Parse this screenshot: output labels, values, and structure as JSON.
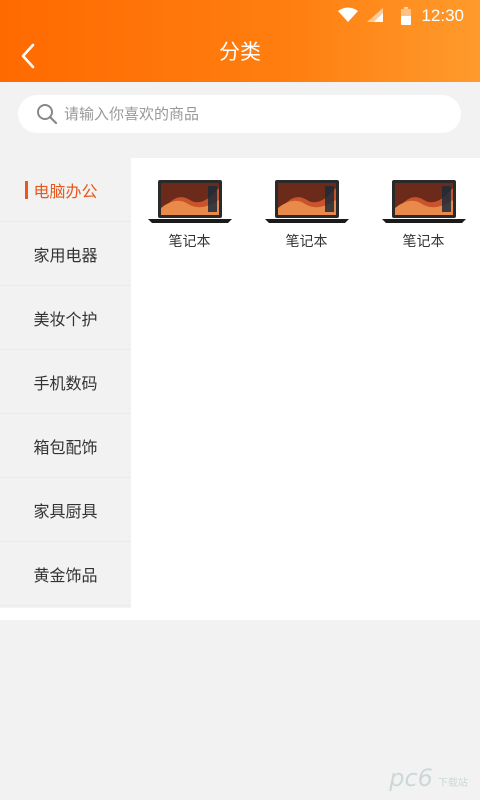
{
  "status_bar": {
    "time": "12:30",
    "icons": [
      "wifi-icon",
      "signal-icon",
      "battery-icon"
    ]
  },
  "header": {
    "title": "分类",
    "back_icon": "back-arrow-icon",
    "gradient_start": "#ff6a00",
    "gradient_end": "#ff9a2c"
  },
  "search": {
    "placeholder": "请输入你喜欢的商品",
    "value": "",
    "icon": "search-icon"
  },
  "sidebar": {
    "active_color": "#e8581c",
    "items": [
      {
        "label": "电脑办公",
        "active": true
      },
      {
        "label": "家用电器",
        "active": false
      },
      {
        "label": "美妆个护",
        "active": false
      },
      {
        "label": "手机数码",
        "active": false
      },
      {
        "label": "箱包配饰",
        "active": false
      },
      {
        "label": "家具厨具",
        "active": false
      },
      {
        "label": "黄金饰品",
        "active": false
      }
    ]
  },
  "products": [
    {
      "name": "笔记本",
      "icon": "laptop-image"
    },
    {
      "name": "笔记本",
      "icon": "laptop-image"
    },
    {
      "name": "笔记本",
      "icon": "laptop-image"
    }
  ],
  "watermark": {
    "logo": "pc6",
    "sub": "下载站"
  }
}
